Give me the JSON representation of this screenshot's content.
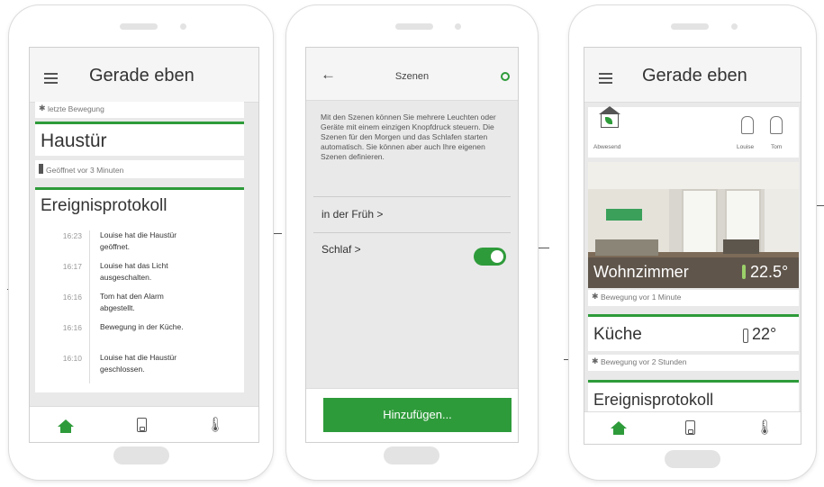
{
  "phone1": {
    "title": "Gerade eben",
    "last_motion": "letzte Bewegung",
    "door_title": "Haustür",
    "door_status": "Geöffnet vor 3 Minuten",
    "log_title": "Ereignisprotokoll",
    "events": [
      {
        "time": "16:23",
        "text": "Louise hat die Haustür geöffnet."
      },
      {
        "time": "16:17",
        "text": "Louise hat das Licht ausgeschalten."
      },
      {
        "time": "16:16",
        "text": "Tom hat den Alarm abgestellt."
      },
      {
        "time": "16:16",
        "text": "Bewegung in der Küche."
      },
      {
        "time": "16:10",
        "text": "Louise hat die Haustür geschlossen."
      }
    ]
  },
  "phone2": {
    "title": "Szenen",
    "description": "Mit den Szenen können Sie mehrere Leuchten oder Geräte mit einem einzigen Knopfdruck steuern. Die Szenen für den Morgen und das Schlafen starten automatisch. Sie können aber auch Ihre eigenen Szenen definieren.",
    "scene_morning": "in der Früh >",
    "scene_sleep": "Schlaf >",
    "sleep_enabled": true,
    "add_button": "Hinzufügen..."
  },
  "phone3": {
    "title": "Gerade eben",
    "mode_label": "Abwesend",
    "user1": "Louise",
    "user2": "Tom",
    "room1_name": "Wohnzimmer",
    "room1_temp": "22.5°",
    "room1_motion": "Bewegung vor 1 Minute",
    "room2_name": "Küche",
    "room2_temp": "22°",
    "room2_motion": "Bewegung vor 2 Stunden",
    "log_title": "Ereignisprotokoll"
  },
  "colors": {
    "accent": "#2e9b3a",
    "screen_bg": "#e9e9e9"
  },
  "icons": [
    "menu-icon",
    "back-arrow-icon",
    "status-ring-icon",
    "home-icon",
    "device-icon",
    "thermometer-icon",
    "motion-icon",
    "door-icon",
    "user-icon"
  ]
}
